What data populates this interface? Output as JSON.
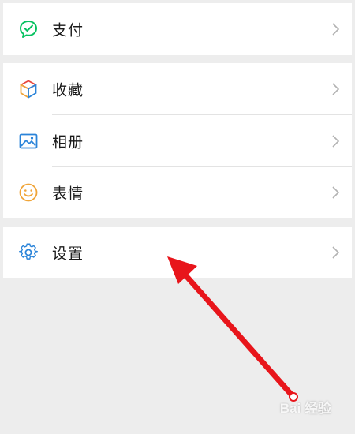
{
  "menu": {
    "pay": {
      "label": "支付",
      "icon": "wechat-pay-icon"
    },
    "favorites": {
      "label": "收藏",
      "icon": "cube-icon"
    },
    "album": {
      "label": "相册",
      "icon": "image-icon"
    },
    "stickers": {
      "label": "表情",
      "icon": "smiley-icon"
    },
    "settings": {
      "label": "设置",
      "icon": "gear-icon"
    }
  },
  "colors": {
    "green": "#07c160",
    "blue": "#2b84d9",
    "orange": "#f0a53a",
    "arrow_red": "#e8151b",
    "background": "#ededed"
  },
  "watermark": {
    "text": "Bai 经验"
  }
}
